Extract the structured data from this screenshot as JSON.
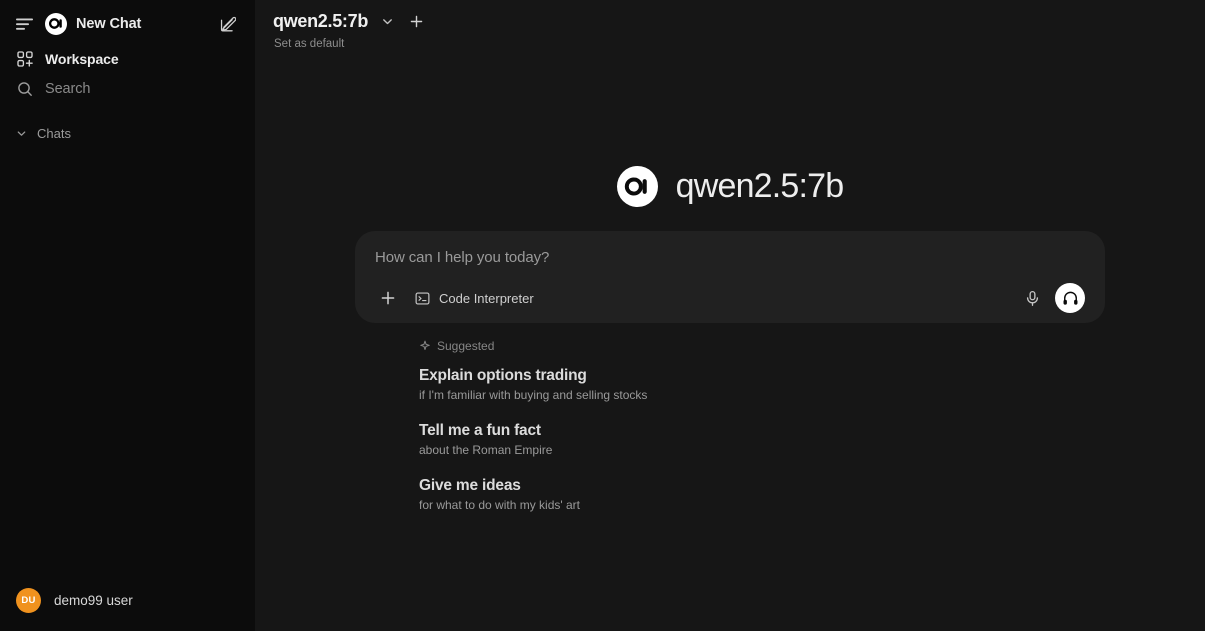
{
  "colors": {
    "app_bg": "#161616",
    "sidebar_bg": "#0c0c0c",
    "composer_bg": "#212121",
    "avatar_bg": "#f0921e",
    "accent_white": "#ffffff"
  },
  "sidebar": {
    "menu_icon": "hamburger-icon",
    "logo_text": "OI",
    "new_chat_label": "New Chat",
    "edit_icon": "pencil-square-icon",
    "items": [
      {
        "label": "Workspace",
        "icon": "grid-plus-icon"
      },
      {
        "label": "Search",
        "icon": "search-icon"
      }
    ],
    "section": {
      "label": "Chats",
      "icon": "chevron-down-icon"
    },
    "user": {
      "initials": "DU",
      "name": "demo99 user"
    }
  },
  "topbar": {
    "model": "qwen2.5:7b",
    "chevron_icon": "chevron-down-icon",
    "plus_icon": "plus-icon",
    "set_default_label": "Set as default"
  },
  "hero": {
    "logo_text": "OI",
    "title": "qwen2.5:7b"
  },
  "composer": {
    "placeholder": "How can I help you today?",
    "value": "",
    "plus_icon": "plus-icon",
    "tool": {
      "label": "Code Interpreter",
      "icon": "terminal-icon"
    },
    "mic_icon": "microphone-icon",
    "call_icon": "headphones-icon"
  },
  "suggested": {
    "header": "Suggested",
    "header_icon": "sparkle-icon",
    "items": [
      {
        "title": "Explain options trading",
        "subtitle": "if I'm familiar with buying and selling stocks"
      },
      {
        "title": "Tell me a fun fact",
        "subtitle": "about the Roman Empire"
      },
      {
        "title": "Give me ideas",
        "subtitle": "for what to do with my kids' art"
      }
    ]
  }
}
